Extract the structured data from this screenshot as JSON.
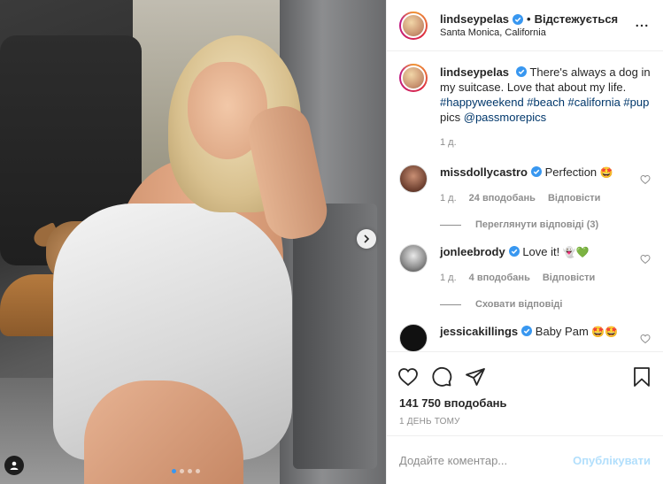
{
  "post": {
    "author": "lindseypelas",
    "follow_sep": "•",
    "follow_status": "Відстежується",
    "location": "Santa Monica, California"
  },
  "caption": {
    "username": "lindseypelas",
    "text": "There's always a dog in my suitcase. Love that about my life.",
    "hashtags": "#happyweekend #beach #california #pup",
    "tail": "pics",
    "mention": "@passmorepics",
    "time": "1 д."
  },
  "comments": [
    {
      "username": "missdollycastro",
      "text": "Perfection",
      "emoji": "🤩",
      "time": "1 д.",
      "likes": "24 вподобань",
      "reply": "Відповісти",
      "thread": "Переглянути відповіді (3)"
    },
    {
      "username": "jonleebrody",
      "text": "Love it!",
      "emoji": "👻💚",
      "time": "1 д.",
      "likes": "4 вподобань",
      "reply": "Відповісти",
      "thread": "Сховати відповіді"
    },
    {
      "username": "jessicakillings",
      "text": "Baby Pam",
      "emoji": "🤩🤩"
    }
  ],
  "stats": {
    "likes": "141 750 вподобань",
    "date": "1 ДЕНЬ ТОМУ"
  },
  "composer": {
    "placeholder": "Додайте коментар...",
    "publish": "Опублікувати"
  },
  "icons": {
    "like": "heart-icon",
    "comment": "comment-icon",
    "share": "share-icon",
    "save": "bookmark-icon",
    "more": "more-icon",
    "verified": "verified-badge-icon",
    "next": "chevron-right-icon",
    "tagged": "user-tag-icon"
  },
  "colors": {
    "verified": "#3897f0",
    "link": "#00376b",
    "publish_disabled": "#b2dffc",
    "muted": "#8e8e8e"
  },
  "carousel": {
    "slides": 4,
    "active": 1
  }
}
